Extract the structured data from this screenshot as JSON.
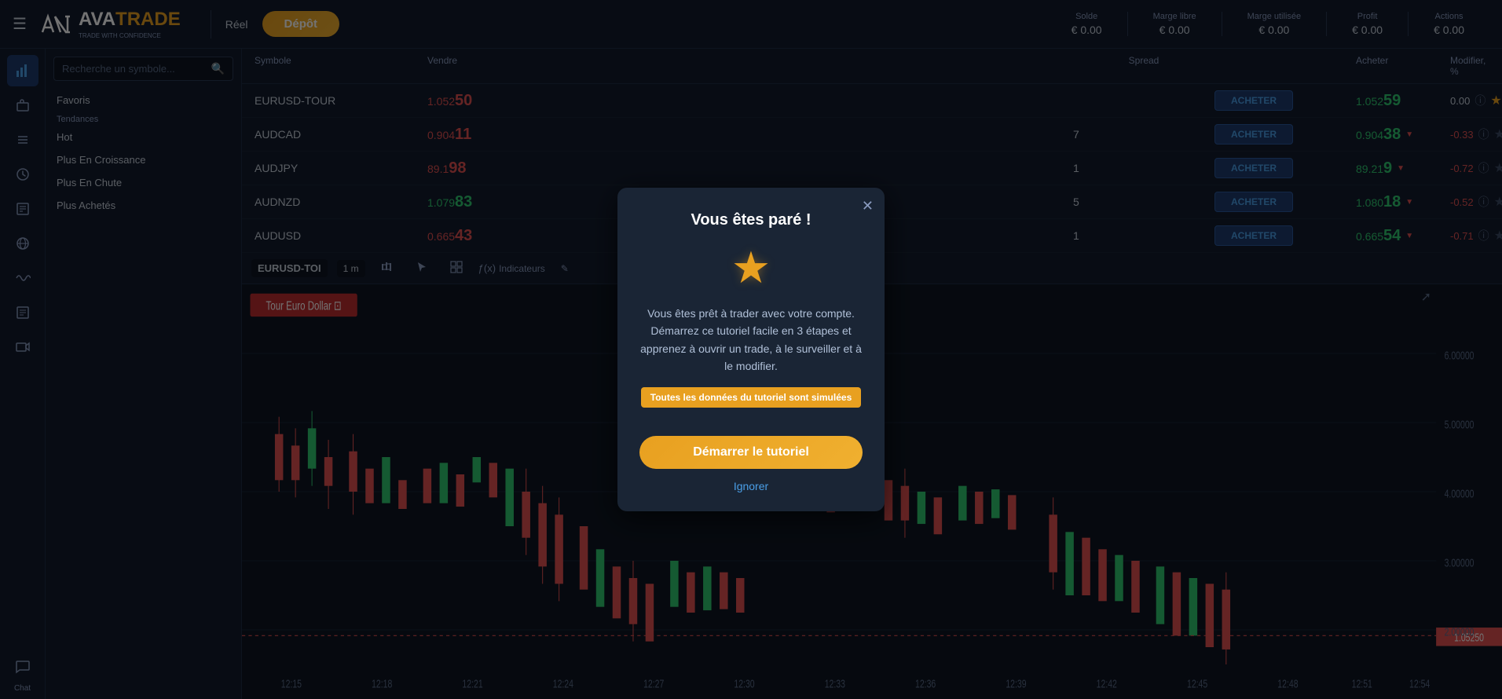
{
  "topbar": {
    "menu_label": "☰",
    "logo_ava": "AVA",
    "logo_trade": "TRADE",
    "logo_tagline": "TRADE WITH CONFIDENCE",
    "divider_visible": true,
    "reel_label": "Réel",
    "depot_label": "Dépôt",
    "stats": [
      {
        "label": "Solde",
        "value": "€ 0.00"
      },
      {
        "label": "Marge libre",
        "value": "€ 0.00"
      },
      {
        "label": "Marge utilisée",
        "value": "€ 0.00"
      },
      {
        "label": "Profit",
        "value": "€ 0.00"
      },
      {
        "label": "Actions",
        "value": "€ 0.00"
      }
    ]
  },
  "sidebar": {
    "search_placeholder": "Recherche un symbole...",
    "favorites_label": "Favoris",
    "trends_label": "Tendances",
    "trend_items": [
      {
        "label": "Hot"
      },
      {
        "label": "Plus En Croissance"
      },
      {
        "label": "Plus En Chute"
      },
      {
        "label": "Plus Achetés"
      }
    ]
  },
  "table": {
    "headers": [
      "Symbole",
      "Vendre",
      "",
      "Spread",
      "",
      "Acheter",
      "Modifier, %"
    ],
    "rows": [
      {
        "symbol": "EURUSD-TOUR",
        "sell": "1.05250",
        "sell_color": "red",
        "spread": "",
        "buy_label": "ACHETER",
        "ask": "1.05259",
        "modifier": "0.00",
        "modifier_color": "neutral",
        "starred": true
      },
      {
        "symbol": "AUDCAD",
        "sell": "0.90411",
        "sell_color": "red",
        "spread": "7",
        "buy_label": "ACHETER",
        "ask": "0.90438",
        "modifier": "-0.33",
        "modifier_color": "negative",
        "starred": true
      },
      {
        "symbol": "AUDJPY",
        "sell": "89.198",
        "sell_color": "red",
        "spread": "1",
        "buy_label": "ACHETER",
        "ask": "89.219",
        "modifier": "-0.72",
        "modifier_color": "negative",
        "starred": true
      },
      {
        "symbol": "AUDNZD",
        "sell": "1.07983",
        "sell_color": "green",
        "spread": "5",
        "buy_label": "ACHETER",
        "ask": "1.08018",
        "modifier": "-0.52",
        "modifier_color": "negative",
        "starred": true
      },
      {
        "symbol": "AUDUSD",
        "sell": "0.66543",
        "sell_color": "red",
        "spread": "1",
        "buy_label": "ACHETER",
        "ask": "0.66554",
        "modifier": "-0.71",
        "modifier_color": "negative",
        "starred": true
      }
    ]
  },
  "chart": {
    "symbol": "EURUSD-TOI",
    "timeframe": "1 m",
    "chart_label": "Tour Euro Dollar",
    "price_scale": [
      "6.00000",
      "4.00000",
      "2.00000"
    ],
    "current_price": "1.05250",
    "time_labels": [
      "12:15",
      "12:18",
      "12:21",
      "12:24",
      "12:27",
      "12:30",
      "12:33",
      "12:36",
      "12:39",
      "12:42",
      "12:45",
      "12:48",
      "12:51",
      "12:54"
    ],
    "indicators_label": "Indicateurs",
    "expand_icon": "⤢"
  },
  "modal": {
    "title": "Vous êtes paré !",
    "star_icon": "★",
    "body_text": "Vous êtes prêt à trader avec votre compte. Démarrez ce tutoriel facile en 3 étapes et apprenez à ouvrir un trade, à le surveiller et à le modifier.",
    "notice_text": "Toutes les données du tutoriel sont simulées",
    "start_btn_label": "Démarrer le tutoriel",
    "ignore_label": "Ignorer",
    "close_icon": "✕"
  },
  "nav_icons": [
    {
      "name": "chart-icon",
      "symbol": "📊",
      "active": true
    },
    {
      "name": "briefcase-icon",
      "symbol": "💼",
      "active": false
    },
    {
      "name": "list-icon",
      "symbol": "☰",
      "active": false
    },
    {
      "name": "clock-icon",
      "symbol": "🕐",
      "active": false
    },
    {
      "name": "orders-icon",
      "symbol": "≡",
      "active": false
    },
    {
      "name": "globe-icon",
      "symbol": "🌐",
      "active": false
    },
    {
      "name": "wave-icon",
      "symbol": "〜",
      "active": false
    },
    {
      "name": "newspaper-icon",
      "symbol": "📰",
      "active": false
    },
    {
      "name": "video-icon",
      "symbol": "▶",
      "active": false
    },
    {
      "name": "chat-icon",
      "symbol": "💬",
      "active": false
    }
  ],
  "chat_label": "Chat"
}
